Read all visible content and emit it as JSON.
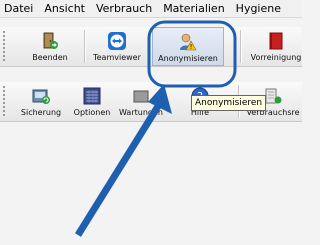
{
  "menubar": {
    "items": [
      {
        "label": "Datei"
      },
      {
        "label": "Ansicht"
      },
      {
        "label": "Verbrauch"
      },
      {
        "label": "Materialien"
      },
      {
        "label": "Hygiene"
      }
    ]
  },
  "toolbar_top": {
    "buttons": [
      {
        "label": "Beenden",
        "icon": "door-exit-icon"
      },
      {
        "label": "Teamviewer",
        "icon": "teamviewer-icon"
      },
      {
        "label": "Anonymisieren",
        "icon": "user-anonymize-icon"
      },
      {
        "label": "Vorreinigung",
        "icon": "red-book-icon"
      }
    ]
  },
  "toolbar_bottom": {
    "buttons": [
      {
        "label": "Sicherung",
        "icon": "backup-icon"
      },
      {
        "label": "Optionen",
        "icon": "options-icon"
      },
      {
        "label": "Wartungen",
        "icon": "maintenance-icon"
      },
      {
        "label": "Hilfe",
        "icon": "help-icon"
      },
      {
        "label": "Verbrauchsre",
        "icon": "consumption-icon"
      }
    ]
  },
  "tooltip": {
    "text": "Anonymisieren"
  },
  "colors": {
    "annotation_blue": "#1f5fb0",
    "tooltip_bg": "#ffffe1"
  }
}
